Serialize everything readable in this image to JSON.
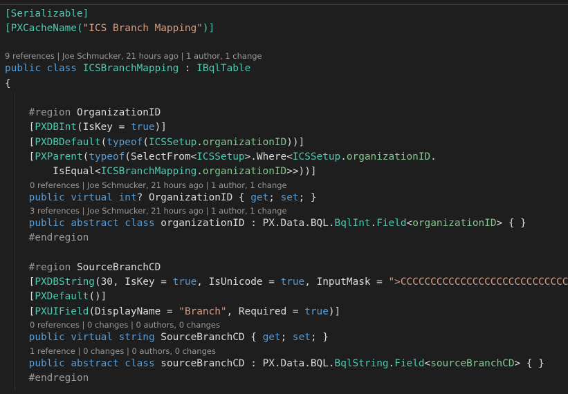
{
  "lines": [
    {
      "kind": "code",
      "id": "l1",
      "parts": [
        [
          "attr",
          "[Serializable]"
        ]
      ]
    },
    {
      "kind": "code",
      "id": "l2",
      "parts": [
        [
          "attr",
          "[PXCacheName("
        ],
        [
          "str",
          "\"ICS Branch Mapping\""
        ],
        [
          "attr",
          ")]"
        ]
      ]
    },
    {
      "kind": "lens",
      "id": "lens1",
      "text": "9 references | Joe Schmucker, 21 hours ago | 1 author, 1 change"
    },
    {
      "kind": "code",
      "id": "l3",
      "parts": [
        [
          "kw",
          "public "
        ],
        [
          "kw",
          "class "
        ],
        [
          "type",
          "ICSBranchMapping"
        ],
        [
          "plain",
          " : "
        ],
        [
          "type",
          "IBqlTable"
        ]
      ]
    },
    {
      "kind": "code",
      "id": "l4",
      "parts": [
        [
          "plain",
          "{"
        ]
      ]
    },
    {
      "kind": "code",
      "id": "l5",
      "parts": [
        [
          "pp",
          "    #region "
        ],
        [
          "plain",
          "OrganizationID"
        ]
      ]
    },
    {
      "kind": "code",
      "id": "l6",
      "parts": [
        [
          "plain",
          "    ["
        ],
        [
          "attr",
          "PXDBInt"
        ],
        [
          "plain",
          "(IsKey = "
        ],
        [
          "kw",
          "true"
        ],
        [
          "plain",
          ")]"
        ]
      ]
    },
    {
      "kind": "code",
      "id": "l7",
      "parts": [
        [
          "plain",
          "    ["
        ],
        [
          "attr",
          "PXDBDefault"
        ],
        [
          "plain",
          "("
        ],
        [
          "kw",
          "typeof"
        ],
        [
          "plain",
          "("
        ],
        [
          "type",
          "ICSSetup"
        ],
        [
          "plain",
          "."
        ],
        [
          "kwgreen",
          "organizationID"
        ],
        [
          "plain",
          "))]"
        ]
      ]
    },
    {
      "kind": "code",
      "id": "l8",
      "parts": [
        [
          "plain",
          "    ["
        ],
        [
          "attr",
          "PXParent"
        ],
        [
          "plain",
          "("
        ],
        [
          "kw",
          "typeof"
        ],
        [
          "plain",
          "(SelectFrom<"
        ],
        [
          "type",
          "ICSSetup"
        ],
        [
          "plain",
          ">.Where<"
        ],
        [
          "type",
          "ICSSetup"
        ],
        [
          "plain",
          "."
        ],
        [
          "kwgreen",
          "organizationID"
        ],
        [
          "plain",
          "."
        ]
      ]
    },
    {
      "kind": "code",
      "id": "l9",
      "parts": [
        [
          "plain",
          "        IsEqual<"
        ],
        [
          "type",
          "ICSBranchMapping"
        ],
        [
          "plain",
          "."
        ],
        [
          "kwgreen",
          "organizationID"
        ],
        [
          "plain",
          ">>))]"
        ]
      ]
    },
    {
      "kind": "lens",
      "id": "lens2",
      "text": "0 references | Joe Schmucker, 21 hours ago | 1 author, 1 change"
    },
    {
      "kind": "code",
      "id": "l10",
      "parts": [
        [
          "kw",
          "    public "
        ],
        [
          "kw",
          "virtual "
        ],
        [
          "kw",
          "int"
        ],
        [
          "plain",
          "? OrganizationID { "
        ],
        [
          "kw",
          "get"
        ],
        [
          "plain",
          "; "
        ],
        [
          "kw",
          "set"
        ],
        [
          "plain",
          "; }"
        ]
      ]
    },
    {
      "kind": "lens",
      "id": "lens3",
      "text": "3 references | Joe Schmucker, 21 hours ago | 1 author, 1 change"
    },
    {
      "kind": "code",
      "id": "l11",
      "parts": [
        [
          "kw",
          "    public "
        ],
        [
          "kw",
          "abstract "
        ],
        [
          "kw",
          "class "
        ],
        [
          "plain",
          "organizationID : PX.Data.BQL."
        ],
        [
          "type",
          "BqlInt"
        ],
        [
          "plain",
          "."
        ],
        [
          "type",
          "Field"
        ],
        [
          "plain",
          "<"
        ],
        [
          "kwgreen",
          "organizationID"
        ],
        [
          "plain",
          "> { }"
        ]
      ]
    },
    {
      "kind": "code",
      "id": "l12",
      "parts": [
        [
          "pp",
          "    #endregion"
        ]
      ]
    },
    {
      "kind": "code",
      "id": "l13",
      "parts": [
        [
          "pp",
          "    #region "
        ],
        [
          "plain",
          "SourceBranchCD"
        ]
      ]
    },
    {
      "kind": "code",
      "id": "l14",
      "parts": [
        [
          "plain",
          "    ["
        ],
        [
          "attr",
          "PXDBString"
        ],
        [
          "plain",
          "(30, IsKey = "
        ],
        [
          "kw",
          "true"
        ],
        [
          "plain",
          ", IsUnicode = "
        ],
        [
          "kw",
          "true"
        ],
        [
          "plain",
          ", InputMask = "
        ],
        [
          "str",
          "\">CCCCCCCCCCCCCCCCCCCCCCCCCCCC"
        ]
      ]
    },
    {
      "kind": "code",
      "id": "l15",
      "parts": [
        [
          "plain",
          "    ["
        ],
        [
          "attr",
          "PXDefault"
        ],
        [
          "plain",
          "()]"
        ]
      ]
    },
    {
      "kind": "code",
      "id": "l16",
      "parts": [
        [
          "plain",
          "    ["
        ],
        [
          "attr",
          "PXUIField"
        ],
        [
          "plain",
          "(DisplayName = "
        ],
        [
          "str",
          "\"Branch\""
        ],
        [
          "plain",
          ", Required = "
        ],
        [
          "kw",
          "true"
        ],
        [
          "plain",
          ")]"
        ]
      ]
    },
    {
      "kind": "lens",
      "id": "lens4",
      "text": "0 references | 0 changes | 0 authors, 0 changes"
    },
    {
      "kind": "code",
      "id": "l17",
      "parts": [
        [
          "kw",
          "    public "
        ],
        [
          "kw",
          "virtual "
        ],
        [
          "kw",
          "string "
        ],
        [
          "plain",
          "SourceBranchCD { "
        ],
        [
          "kw",
          "get"
        ],
        [
          "plain",
          "; "
        ],
        [
          "kw",
          "set"
        ],
        [
          "plain",
          "; }"
        ]
      ]
    },
    {
      "kind": "lens",
      "id": "lens5",
      "text": "1 reference | 0 changes | 0 authors, 0 changes"
    },
    {
      "kind": "code",
      "id": "l18",
      "parts": [
        [
          "kw",
          "    public "
        ],
        [
          "kw",
          "abstract "
        ],
        [
          "kw",
          "class "
        ],
        [
          "plain",
          "sourceBranchCD : PX.Data.BQL."
        ],
        [
          "type",
          "BqlString"
        ],
        [
          "plain",
          "."
        ],
        [
          "type",
          "Field"
        ],
        [
          "plain",
          "<"
        ],
        [
          "kwgreen",
          "sourceBranchCD"
        ],
        [
          "plain",
          "> { }"
        ]
      ]
    },
    {
      "kind": "code",
      "id": "l19",
      "parts": [
        [
          "pp",
          "    #endregion"
        ]
      ]
    }
  ]
}
